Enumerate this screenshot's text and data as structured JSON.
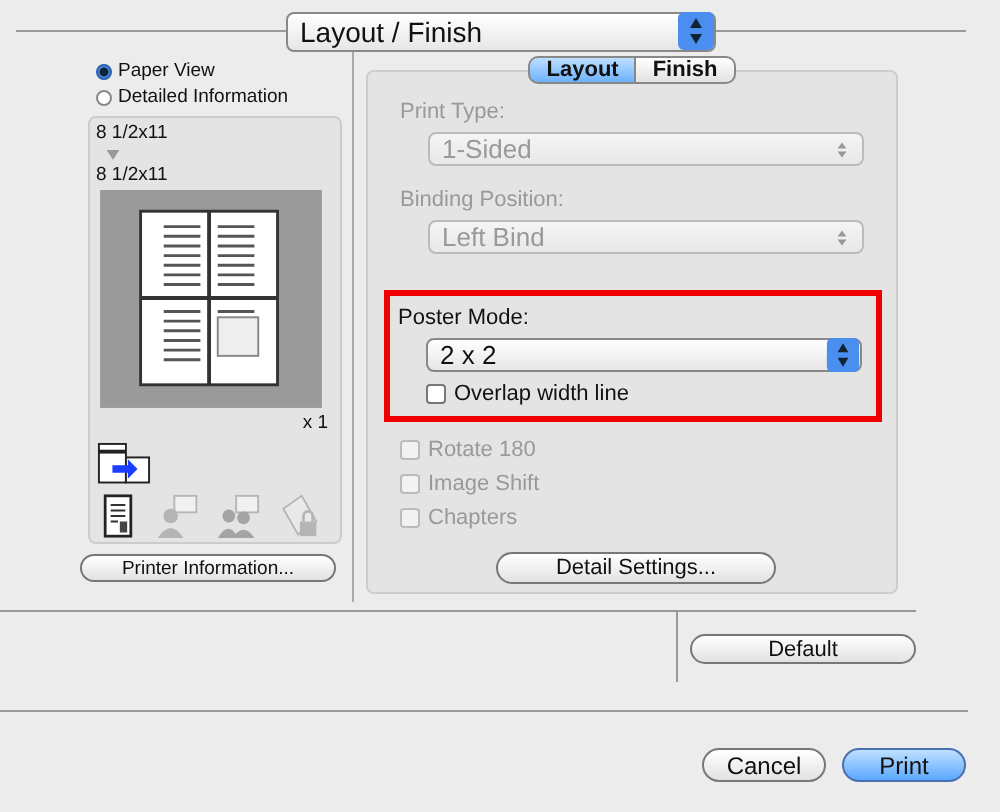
{
  "preset_popup": {
    "value": "Layout / Finish"
  },
  "view_options": [
    {
      "label": "Paper View",
      "selected": true
    },
    {
      "label": "Detailed Information",
      "selected": false
    }
  ],
  "preview": {
    "original_size": "8 1/2x11",
    "output_size": "8 1/2x11",
    "copies": "x 1"
  },
  "tool_icons": [
    {
      "disabled": false
    },
    {
      "disabled": true
    },
    {
      "disabled": true
    },
    {
      "disabled": true
    }
  ],
  "printer_info_button": "Printer Information...",
  "tabs": [
    {
      "label": "Layout",
      "selected": true
    },
    {
      "label": "Finish",
      "selected": false
    }
  ],
  "print_type": {
    "label": "Print Type:",
    "value": "1-Sided",
    "disabled": true
  },
  "binding_position": {
    "label": "Binding Position:",
    "value": "Left Bind",
    "disabled": true
  },
  "poster_mode": {
    "label": "Poster Mode:",
    "value": "2 x 2",
    "disabled": false,
    "highlighted": true
  },
  "overlap": {
    "label": "Overlap width line",
    "checked": false,
    "disabled": false
  },
  "options": [
    {
      "label": "Rotate 180",
      "checked": false,
      "disabled": true
    },
    {
      "label": "Image Shift",
      "checked": false,
      "disabled": true
    },
    {
      "label": "Chapters",
      "checked": false,
      "disabled": true
    }
  ],
  "detail_settings_button": "Detail Settings...",
  "default_button": "Default",
  "buttons": [
    {
      "label": "Cancel",
      "default": false
    },
    {
      "label": "Print",
      "default": true
    }
  ]
}
